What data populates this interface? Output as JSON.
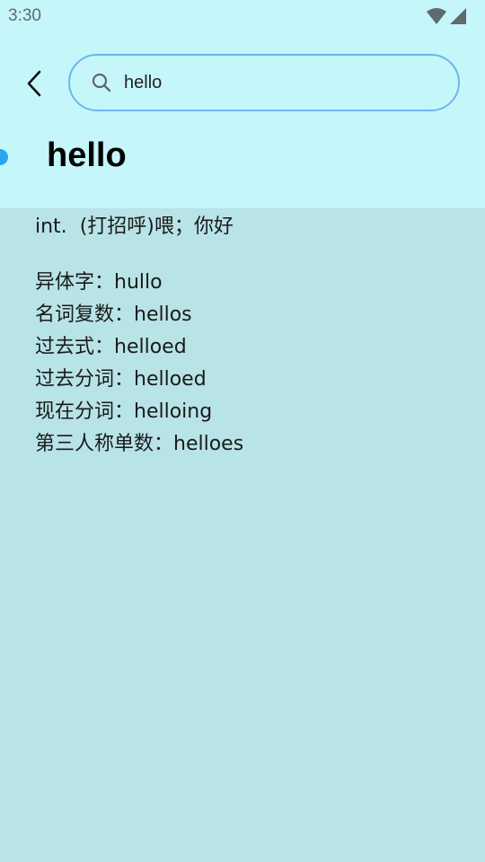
{
  "status_bar": {
    "time": "3:30"
  },
  "search": {
    "value": "hello"
  },
  "entry": {
    "word": "hello",
    "part_of_speech": "int.",
    "meaning": "(打招呼)喂；你好",
    "forms": [
      {
        "label": "异体字：",
        "value": "hullo"
      },
      {
        "label": "名词复数：",
        "value": "hellos"
      },
      {
        "label": "过去式：",
        "value": "helloed"
      },
      {
        "label": "过去分词：",
        "value": "helloed"
      },
      {
        "label": "现在分词：",
        "value": "helloing"
      },
      {
        "label": "第三人称单数：",
        "value": "helloes"
      }
    ]
  },
  "icons": {
    "back": "chevron-left-icon",
    "search": "search-icon",
    "wifi": "wifi-icon",
    "signal": "signal-icon"
  },
  "colors": {
    "header_bg": "#c5f6fa",
    "content_bg": "#b8e3e7",
    "accent": "#2ba6f0",
    "search_border": "#6eb5ee"
  }
}
